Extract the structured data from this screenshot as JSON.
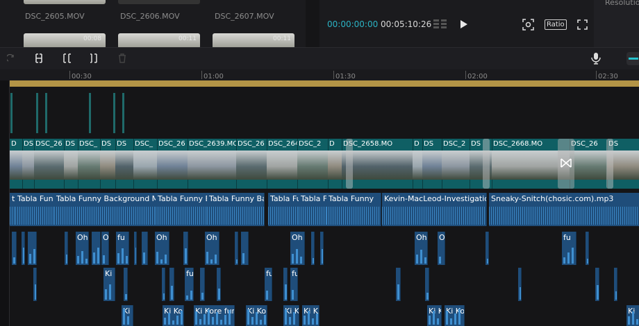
{
  "media": {
    "files": [
      {
        "name": "DSC_2605.MOV"
      },
      {
        "name": "DSC_2606.MOV"
      },
      {
        "name": "DSC_2607.MOV"
      }
    ],
    "second_row_durations": [
      "00:08",
      "00:11",
      "00:11"
    ]
  },
  "player": {
    "current_time": "00:00:00:00",
    "total_time": "00:05:10:26",
    "ratio_label": "Ratio",
    "resolution_label": "Resolutio"
  },
  "ruler": {
    "ticks": [
      "00:30",
      "01:00",
      "01:30",
      "02:00",
      "02:30"
    ]
  },
  "video_clips": [
    {
      "label": "D"
    },
    {
      "label": "DS"
    },
    {
      "label": "DSC_26"
    },
    {
      "label": "DS"
    },
    {
      "label": "DSC_"
    },
    {
      "label": "DS"
    },
    {
      "label": "DS"
    },
    {
      "label": "DSC_"
    },
    {
      "label": "DSC_26"
    },
    {
      "label": "DSC_2639.MO"
    },
    {
      "label": "DSC_26"
    },
    {
      "label": "DSC_264"
    },
    {
      "label": "DSC_2"
    },
    {
      "label": "D"
    },
    {
      "label": "DSC_2658.MO"
    },
    {
      "label": "D"
    },
    {
      "label": "DS"
    },
    {
      "label": "DSC_2"
    },
    {
      "label": "DS"
    },
    {
      "label": "DSC_2668.MO"
    },
    {
      "label": "DSC_26"
    },
    {
      "label": "DS"
    }
  ],
  "audio_clips": [
    {
      "label": "ta"
    },
    {
      "label": "Tabla Fun"
    },
    {
      "label": "Tabla Funny Background M"
    },
    {
      "label": "Tabla Funny E"
    },
    {
      "label": "Tabla Funny Ba"
    },
    {
      "label": "Tabla Fu"
    },
    {
      "label": "Tabla F"
    },
    {
      "label": "Tabla Funny"
    },
    {
      "label": "Kevin-MacLeod-Investigatio"
    },
    {
      "label": "Sneaky-Snitch(chosic.com).mp3"
    }
  ],
  "sfx_row1": [
    "Oh",
    "Oh",
    "fu",
    "Oh",
    "Oh",
    "Oh",
    "Oh",
    "Oh",
    "fu",
    "Oh"
  ],
  "sfx_row2": [
    "Ki",
    "fu",
    "fu",
    "fu"
  ],
  "sfx_row3": [
    "Ki I",
    "Ki Ko",
    "Ki Kore fur",
    "Ki Ko",
    "Ki K",
    "Ki K",
    "Ki K",
    "Ki Ko",
    "Ki"
  ]
}
